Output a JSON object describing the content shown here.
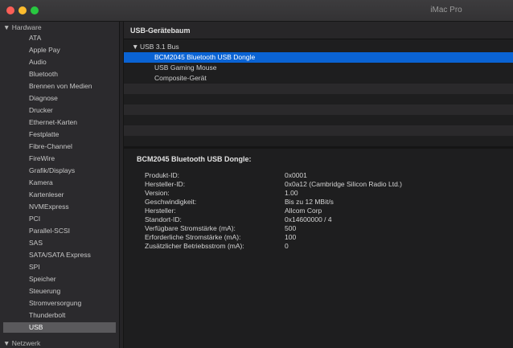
{
  "window": {
    "title": "iMac Pro"
  },
  "sidebar": {
    "hardware_label": "Hardware",
    "items": [
      "ATA",
      "Apple Pay",
      "Audio",
      "Bluetooth",
      "Brennen von Medien",
      "Diagnose",
      "Drucker",
      "Ethernet-Karten",
      "Festplatte",
      "Fibre-Channel",
      "FireWire",
      "Grafik/Displays",
      "Kamera",
      "Kartenleser",
      "NVMExpress",
      "PCI",
      "Parallel-SCSI",
      "SAS",
      "SATA/SATA Express",
      "SPI",
      "Speicher",
      "Steuerung",
      "Stromversorgung",
      "Thunderbolt",
      "USB"
    ],
    "selected_item": "USB",
    "network_label": "Netzwerk"
  },
  "tree": {
    "header": "USB-Gerätebaum",
    "bus": "USB 3.1 Bus",
    "devices": [
      "BCM2045 Bluetooth USB Dongle",
      "USB Gaming Mouse",
      "Composite-Gerät"
    ],
    "selected_device": "BCM2045 Bluetooth USB Dongle"
  },
  "detail": {
    "title": "BCM2045 Bluetooth USB Dongle:",
    "rows": [
      {
        "key": "Produkt-ID:",
        "value": "0x0001"
      },
      {
        "key": "Hersteller-ID:",
        "value": "0x0a12  (Cambridge Silicon Radio Ltd.)"
      },
      {
        "key": "Version:",
        "value": "1.00"
      },
      {
        "key": "Geschwindigkeit:",
        "value": "Bis zu 12 MBit/s"
      },
      {
        "key": "Hersteller:",
        "value": "Allcom Corp"
      },
      {
        "key": "Standort-ID:",
        "value": "0x14600000 / 4"
      },
      {
        "key": "Verfügbare Stromstärke (mA):",
        "value": "500"
      },
      {
        "key": "Erforderliche Stromstärke (mA):",
        "value": "100"
      },
      {
        "key": "Zusätzlicher Betriebsstrom (mA):",
        "value": "0"
      }
    ]
  },
  "colors": {
    "selection": "#0a63d4",
    "sidebar_selection": "#5a595c",
    "background": "#1e1e1f"
  }
}
